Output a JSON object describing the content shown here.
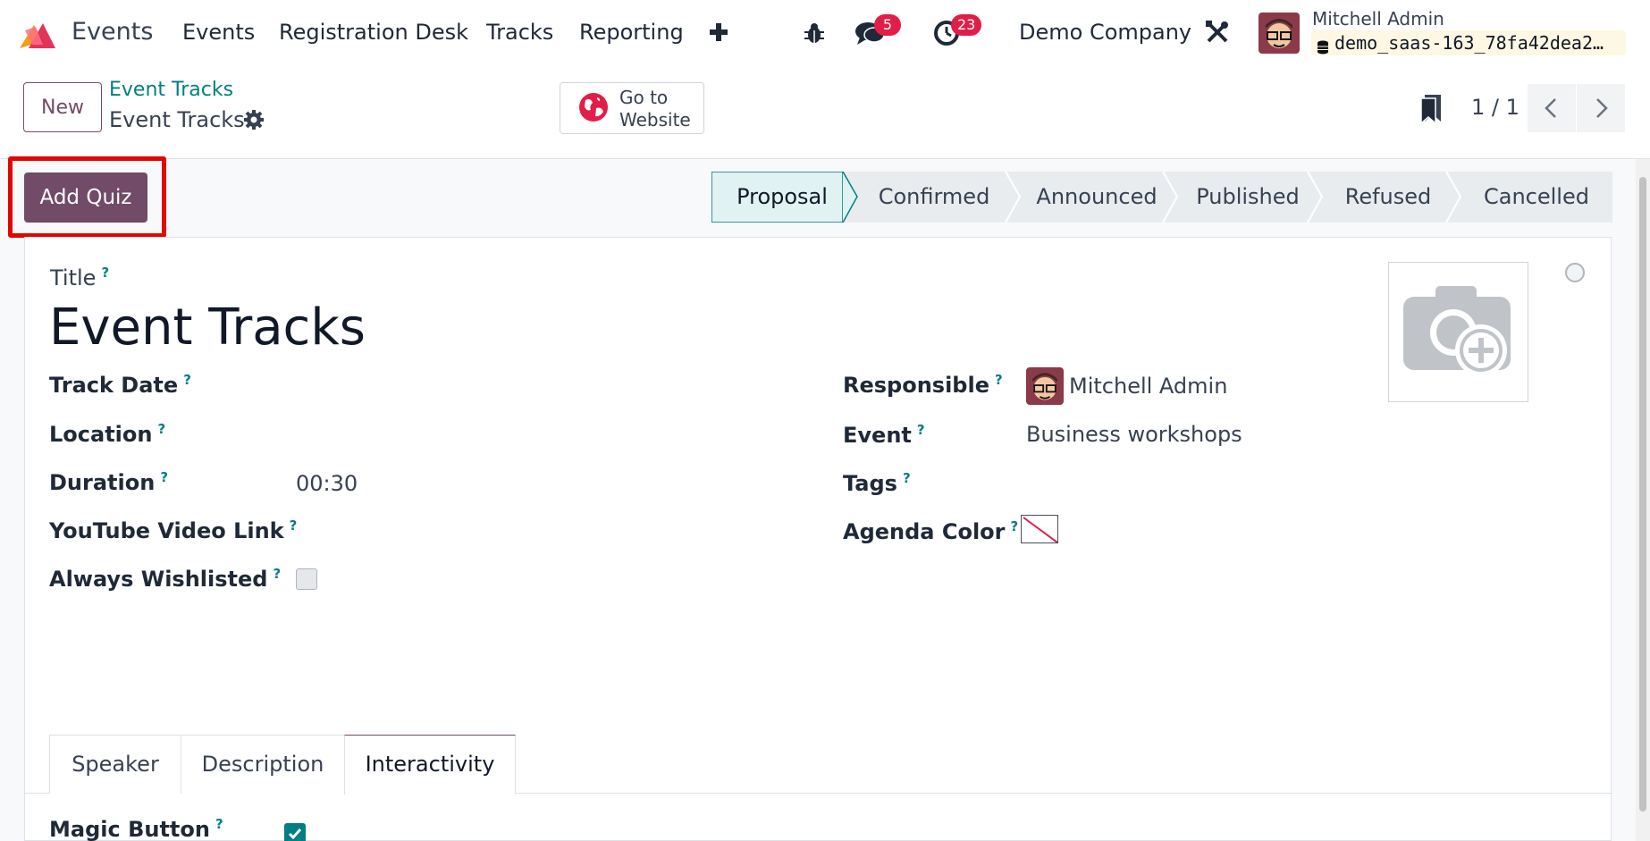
{
  "navbar": {
    "app_name": "Events",
    "menu": [
      "Events",
      "Registration Desk",
      "Tracks",
      "Reporting"
    ],
    "messages_count": "5",
    "activities_count": "23",
    "company": "Demo Company",
    "user_name": "Mitchell Admin",
    "database": "demo_saas-163_78fa42dea2…"
  },
  "control_panel": {
    "new_label": "New",
    "breadcrumb_parent": "Event Tracks",
    "breadcrumb_current": "Event Tracks",
    "website_line1": "Go to",
    "website_line2": "Website",
    "pager": "1 / 1"
  },
  "actions": {
    "add_quiz_label": "Add Quiz"
  },
  "status_stages": [
    "Proposal",
    "Confirmed",
    "Announced",
    "Published",
    "Refused",
    "Cancelled"
  ],
  "status_active": "Proposal",
  "form": {
    "title_label": "Title",
    "title_value": "Event Tracks",
    "left_fields": {
      "track_date": {
        "label": "Track Date",
        "value": ""
      },
      "location": {
        "label": "Location",
        "value": ""
      },
      "duration": {
        "label": "Duration",
        "value": "00:30"
      },
      "youtube": {
        "label": "YouTube Video Link",
        "value": ""
      },
      "wishlisted": {
        "label": "Always Wishlisted",
        "checked": false
      }
    },
    "right_fields": {
      "responsible": {
        "label": "Responsible",
        "value": "Mitchell Admin"
      },
      "event": {
        "label": "Event",
        "value": "Business workshops"
      },
      "tags": {
        "label": "Tags",
        "value": ""
      },
      "agenda_color": {
        "label": "Agenda Color"
      }
    },
    "help_mark": "?",
    "tabs": [
      "Speaker",
      "Description",
      "Interactivity"
    ],
    "active_tab": "Interactivity",
    "magic_button": {
      "label": "Magic Button",
      "checked": true
    }
  },
  "colors": {
    "brand": "#714b67",
    "accent": "#017e84",
    "badge": "#e11d48",
    "highlight": "#e10600"
  }
}
